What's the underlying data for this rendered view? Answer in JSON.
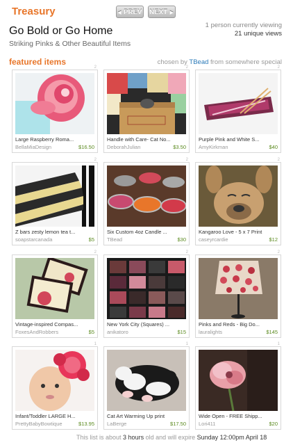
{
  "header": {
    "brand": "Treasury",
    "prev_label": "PREV",
    "next_label": "NEXT",
    "title": "Go Bold or Go Home",
    "subtitle": "Striking Pinks & Other Beautiful Items",
    "viewing": "1 person currently viewing",
    "views": "21 unique views"
  },
  "featured": {
    "heading": "featured items",
    "chosen_prefix": "chosen by",
    "curator": "TBead",
    "from_text": "from",
    "location": "somewhere special"
  },
  "items": [
    {
      "title": "Large Raspberry Roma...",
      "shop": "BellaMiaDesign",
      "price": "$16.50",
      "mark": "2",
      "thumb_icon": "pink-rose-icon"
    },
    {
      "title": "Handle with Care- Cat No...",
      "shop": "DeborahJulian",
      "price": "$3.50",
      "mark": "2",
      "thumb_icon": "cat-box-icon"
    },
    {
      "title": "Purple Pink and White S...",
      "shop": "AmyKirkman",
      "price": "$40",
      "mark": "2",
      "thumb_icon": "glass-plate-icon"
    },
    {
      "title": "Z bars zesty lemon tea t...",
      "shop": "soapstarcanada",
      "price": "$5",
      "mark": "2",
      "thumb_icon": "soap-bars-icon"
    },
    {
      "title": "Six Custom 4oz Candle ...",
      "shop": "TBead",
      "price": "$30",
      "mark": "2",
      "thumb_icon": "candle-tins-icon"
    },
    {
      "title": "Kangaroo Love - 5 x 7 Print",
      "shop": "caseyrcardie",
      "price": "$12",
      "mark": "2",
      "thumb_icon": "kangaroo-icon"
    },
    {
      "title": "Vintage-inspired Compas...",
      "shop": "FoxesAndRobbers",
      "price": "$5",
      "mark": "2",
      "thumb_icon": "tags-icon"
    },
    {
      "title": "New York City (Squares) ...",
      "shop": "anikatoro",
      "price": "$15",
      "mark": "2",
      "thumb_icon": "squares-icon"
    },
    {
      "title": "Pinks and Reds - Big Do...",
      "shop": "lauralights",
      "price": "$145",
      "mark": "2",
      "thumb_icon": "lamp-icon"
    },
    {
      "title": "Infant/Toddler LARGE  H...",
      "shop": "PrettyBabyBowtique",
      "price": "$13.95",
      "mark": "1",
      "thumb_icon": "baby-flower-icon"
    },
    {
      "title": "Cat Art  Warming Up print",
      "shop": "LaBerge",
      "price": "$17.50",
      "mark": "1",
      "thumb_icon": "sleeping-cat-icon"
    },
    {
      "title": "Wide Open - FREE Shipp...",
      "shop": "Lori411",
      "price": "$20",
      "mark": "1",
      "thumb_icon": "pink-flower-icon"
    }
  ],
  "footer": {
    "prefix": "This list is about",
    "age": "3 hours",
    "middle": "old and will expire",
    "expires": "Sunday 12:00pm  April 18"
  },
  "colors": {
    "brand_orange": "#e8762a",
    "link_blue": "#2a7ab8",
    "price_green": "#5a8a1e"
  }
}
